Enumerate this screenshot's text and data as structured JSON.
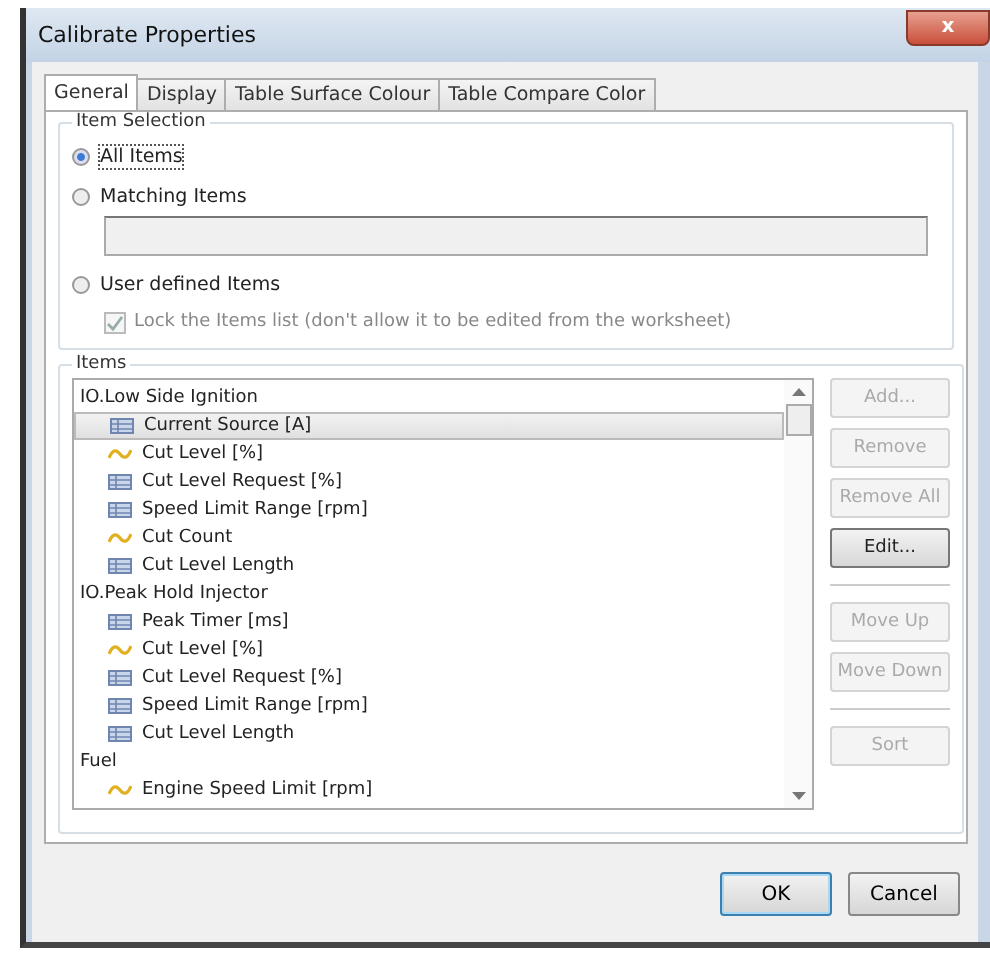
{
  "window": {
    "title": "Calibrate Properties",
    "close": "x"
  },
  "tabs": [
    {
      "label": "General",
      "selected": true
    },
    {
      "label": "Display",
      "selected": false
    },
    {
      "label": "Table Surface Colour",
      "selected": false
    },
    {
      "label": "Table Compare Color",
      "selected": false
    }
  ],
  "item_selection": {
    "title": "Item Selection",
    "options": [
      {
        "label": "All Items",
        "selected": true
      },
      {
        "label": "Matching Items",
        "selected": false
      },
      {
        "label": "User defined Items",
        "selected": false
      }
    ],
    "lock_checkbox": {
      "label": "Lock the Items list (don't allow it to be edited from the worksheet)",
      "checked": true,
      "disabled": true
    }
  },
  "items": {
    "title": "Items",
    "tree": [
      {
        "label": "IO.Low Side Ignition",
        "children": [
          {
            "label": "Current Source [A]",
            "kind": "table",
            "selected": true
          },
          {
            "label": "Cut Level [%]",
            "kind": "curve",
            "selected": false
          },
          {
            "label": "Cut Level Request [%]",
            "kind": "table",
            "selected": false
          },
          {
            "label": "Speed Limit Range [rpm]",
            "kind": "table",
            "selected": false
          },
          {
            "label": "Cut Count",
            "kind": "curve",
            "selected": false
          },
          {
            "label": "Cut Level Length",
            "kind": "table",
            "selected": false
          }
        ]
      },
      {
        "label": "IO.Peak Hold Injector",
        "children": [
          {
            "label": "Peak Timer [ms]",
            "kind": "table",
            "selected": false
          },
          {
            "label": "Cut Level [%]",
            "kind": "curve",
            "selected": false
          },
          {
            "label": "Cut Level Request [%]",
            "kind": "table",
            "selected": false
          },
          {
            "label": "Speed Limit Range [rpm]",
            "kind": "table",
            "selected": false
          },
          {
            "label": "Cut Level Length",
            "kind": "table",
            "selected": false
          }
        ]
      },
      {
        "label": "Fuel",
        "children": [
          {
            "label": "Engine Speed Limit [rpm]",
            "kind": "curve",
            "selected": false
          }
        ]
      }
    ],
    "button_groups": [
      [
        {
          "label": "Add...",
          "disabled": true
        },
        {
          "label": "Remove",
          "disabled": true
        },
        {
          "label": "Remove All",
          "disabled": true
        },
        {
          "label": "Edit...",
          "disabled": false
        }
      ],
      [
        {
          "label": "Move Up",
          "disabled": true
        },
        {
          "label": "Move Down",
          "disabled": true
        }
      ],
      [
        {
          "label": "Sort",
          "disabled": true
        }
      ]
    ]
  },
  "footer_buttons": [
    {
      "label": "OK",
      "default": true
    },
    {
      "label": "Cancel",
      "default": false
    }
  ]
}
